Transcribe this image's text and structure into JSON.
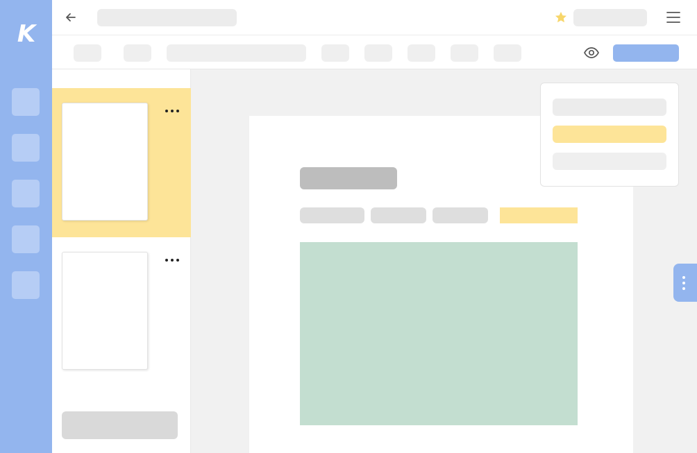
{
  "app": {
    "logo_letter": "K",
    "rail_items": [
      "rail-item-1",
      "rail-item-2",
      "rail-item-3",
      "rail-item-4",
      "rail-item-5"
    ]
  },
  "header": {
    "back_icon": "arrow-left-icon",
    "star_icon": "star-icon",
    "menu_icon": "hamburger-menu-icon"
  },
  "toolbar": {
    "preview_icon": "eye-icon",
    "accent": "#93b5ee"
  },
  "sidebar": {
    "selected_color": "#fde498",
    "more_icon": "more-horizontal-icon"
  },
  "canvas": {
    "image_placeholder_color": "#c3ded0",
    "highlight_color": "#fde498"
  }
}
